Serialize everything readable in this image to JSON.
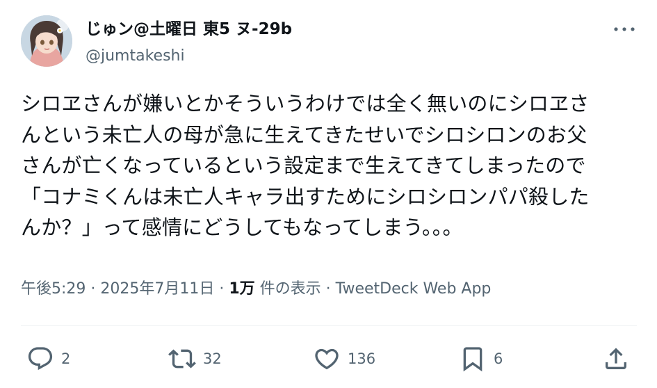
{
  "author": {
    "display_name": "じゅン@土曜日 東5 ヌ-29b",
    "handle": "@jumtakeshi"
  },
  "tweet": {
    "lines": [
      "シロヱさんが嫌いとかそういうわけでは全く無いのにシロヱさ",
      "んという未亡人の母が急に生えてきたせいでシロシロンのお父",
      "さんが亡くなっているという設定まで生えてきてしまったので",
      "「コナミくんは未亡人キャラ出すためにシロシロンパパ殺した",
      "んか？」って感情にどうしてもなってしまう。。。"
    ]
  },
  "meta": {
    "time": "午後5:29",
    "sep1": " · ",
    "date": "2025年7月11日",
    "sep2": " · ",
    "views_count": "1万",
    "views_label": " 件の表示",
    "sep3": " · ",
    "source": "TweetDeck Web App"
  },
  "actions": {
    "replies": "2",
    "retweets": "32",
    "likes": "136",
    "bookmarks": "6"
  },
  "icons": {
    "more": "more-horizontal-icon",
    "reply": "reply-bubble-icon",
    "retweet": "retweet-icon",
    "like": "heart-icon",
    "bookmark": "bookmark-icon",
    "share": "share-icon"
  },
  "colors": {
    "text": "#0f1419",
    "secondary": "#536471",
    "divider": "#eff3f4"
  }
}
